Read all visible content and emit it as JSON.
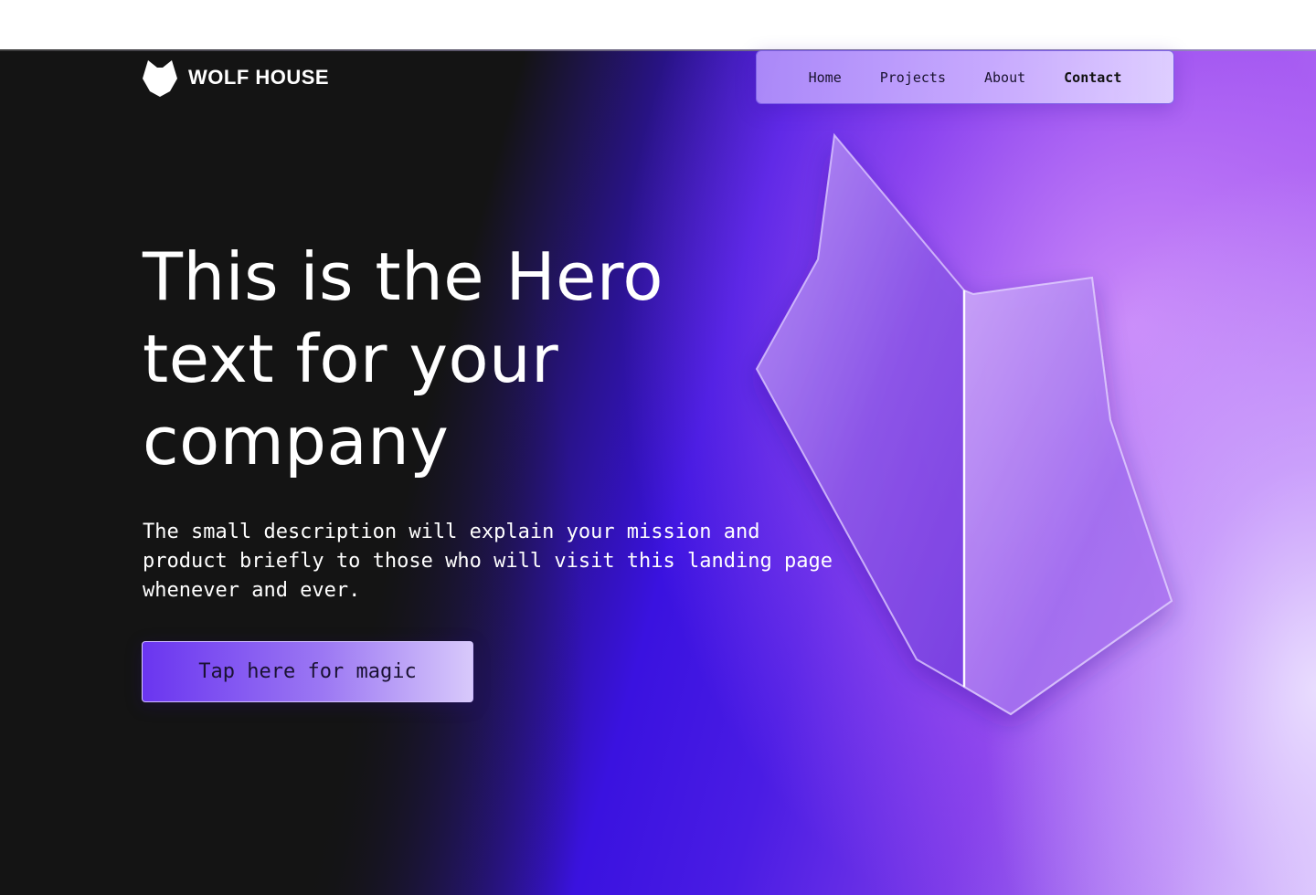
{
  "brand": {
    "logo_icon": "wolf-head-icon",
    "name": "WOLF HOUSE"
  },
  "nav": {
    "items": [
      {
        "label": "Home",
        "active": false
      },
      {
        "label": "Projects",
        "active": false
      },
      {
        "label": "About",
        "active": false
      },
      {
        "label": "Contact",
        "active": true
      }
    ]
  },
  "hero": {
    "headline": "This is the Hero text for your company",
    "description": "The small description will explain your mission and product briefly to those who will visit this landing page whenever and ever.",
    "cta_label": "Tap here for magic",
    "illustration": "wolf-head-3d-icon"
  },
  "colors": {
    "dark_bg": "#141414",
    "accent_blue": "#3a12e0",
    "accent_violet": "#a070f0",
    "text": "#ffffff"
  }
}
